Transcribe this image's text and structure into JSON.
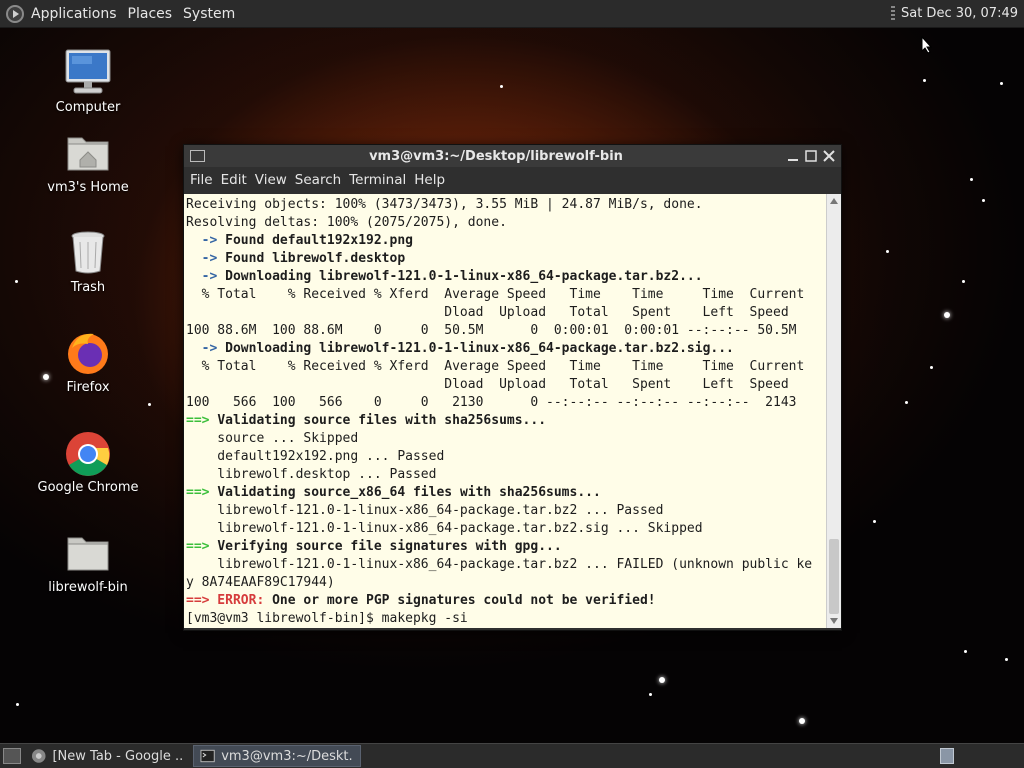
{
  "top_panel": {
    "menu": [
      "Applications",
      "Places",
      "System"
    ],
    "clock": "Sat Dec 30, 07:49"
  },
  "desktop_icons": [
    {
      "label": "Computer",
      "icon": "computer-icon"
    },
    {
      "label": "vm3's Home",
      "icon": "home-folder-icon"
    },
    {
      "label": "Trash",
      "icon": "trash-icon"
    },
    {
      "label": "Firefox",
      "icon": "firefox-icon"
    },
    {
      "label": "Google Chrome",
      "icon": "chrome-icon"
    },
    {
      "label": "librewolf-bin",
      "icon": "folder-icon"
    }
  ],
  "terminal": {
    "title": "vm3@vm3:~/Desktop/librewolf-bin",
    "menu": [
      "File",
      "Edit",
      "View",
      "Search",
      "Terminal",
      "Help"
    ],
    "lines": [
      "Receiving objects: 100% (3473/3473), 3.55 MiB | 24.87 MiB/s, done.",
      "Resolving deltas: 100% (2075/2075), done.",
      "  -> Found default192x192.png",
      "  -> Found librewolf.desktop",
      "  -> Downloading librewolf-121.0-1-linux-x86_64-package.tar.bz2...",
      "  % Total    % Received % Xferd  Average Speed   Time    Time     Time  Current",
      "                                 Dload  Upload   Total   Spent    Left  Speed",
      "100 88.6M  100 88.6M    0     0  50.5M      0  0:00:01  0:00:01 --:--:-- 50.5M",
      "  -> Downloading librewolf-121.0-1-linux-x86_64-package.tar.bz2.sig...",
      "  % Total    % Received % Xferd  Average Speed   Time    Time     Time  Current",
      "                                 Dload  Upload   Total   Spent    Left  Speed",
      "100   566  100   566    0     0   2130      0 --:--:-- --:--:-- --:--:--  2143",
      "==> Validating source files with sha256sums...",
      "    source ... Skipped",
      "    default192x192.png ... Passed",
      "    librewolf.desktop ... Passed",
      "==> Validating source_x86_64 files with sha256sums...",
      "    librewolf-121.0-1-linux-x86_64-package.tar.bz2 ... Passed",
      "    librewolf-121.0-1-linux-x86_64-package.tar.bz2.sig ... Skipped",
      "==> Verifying source file signatures with gpg...",
      "    librewolf-121.0-1-linux-x86_64-package.tar.bz2 ... FAILED (unknown public ke",
      "y 8A74EAAF89C17944)",
      "==> ERROR: One or more PGP signatures could not be verified!",
      "[vm3@vm3 librewolf-bin]$ makepkg -si"
    ]
  },
  "taskbar": {
    "tasks": [
      {
        "label": "[New Tab - Google ...",
        "icon": "chrome-icon",
        "active": false
      },
      {
        "label": "vm3@vm3:~/Deskt...",
        "icon": "terminal-icon",
        "active": true
      }
    ]
  },
  "colors": {
    "terminal_bg": "#fffde8",
    "arrow_blue": "#3465a4",
    "prompt_green": "#3bbf3b",
    "error_red": "#d63c3c",
    "panel_bg": "#2b2b2b"
  }
}
